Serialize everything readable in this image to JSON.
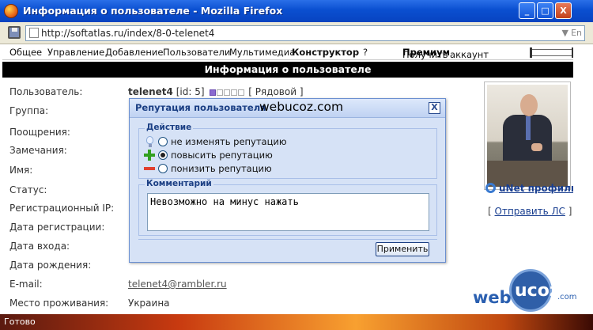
{
  "window": {
    "title": "Информация о пользователе - Mozilla Firefox",
    "buttons": [
      "_",
      "□",
      "X"
    ]
  },
  "address_bar": {
    "url": "http://softatlas.ru/index/8-0-telenet4",
    "lang": "En"
  },
  "nav": {
    "items": [
      "Общее",
      "Управление",
      "Добавление",
      "Пользователи",
      "Мультимедиа",
      "Конструктор",
      "?"
    ],
    "premium_prefix": "Получить",
    "premium_bold": "Премиум",
    "premium_suffix": "аккаунт"
  },
  "page_title": "Информация о пользователе",
  "profile": {
    "labels": [
      "Пользователь:",
      "Группа:",
      "Поощрения:",
      "Замечания:",
      "Имя:",
      "Статус:",
      "Регистрационный IP:",
      "Дата регистрации:",
      "Дата входа:",
      "Дата рождения:",
      "E-mail:",
      "Место проживания:"
    ],
    "username": "telenet4",
    "id_text": "[id: 5]",
    "rank": "[ Рядовой ]",
    "rank_level": 1,
    "rank_max": 5,
    "email": "telenet4@rambler.ru",
    "location": "Украина",
    "unet_link": "uNet профиль",
    "send_pm_open": "[",
    "send_pm_link": "Отправить ЛС",
    "send_pm_close": "]"
  },
  "dialog": {
    "title": "Репутация пользователя",
    "watermark": "webucoz.com",
    "close": "X",
    "action_legend": "Действие",
    "options": [
      "не изменять репутацию",
      "повысить репутацию",
      "понизить репутацию"
    ],
    "selected_option": 1,
    "comment_legend": "Комментарий",
    "comment_text": "Невозможно на минус нажать",
    "apply_button": "Применить"
  },
  "status_bar": "Готово",
  "watermark": {
    "web": "web",
    "ucoz": "ucoz",
    "com": ".com"
  }
}
